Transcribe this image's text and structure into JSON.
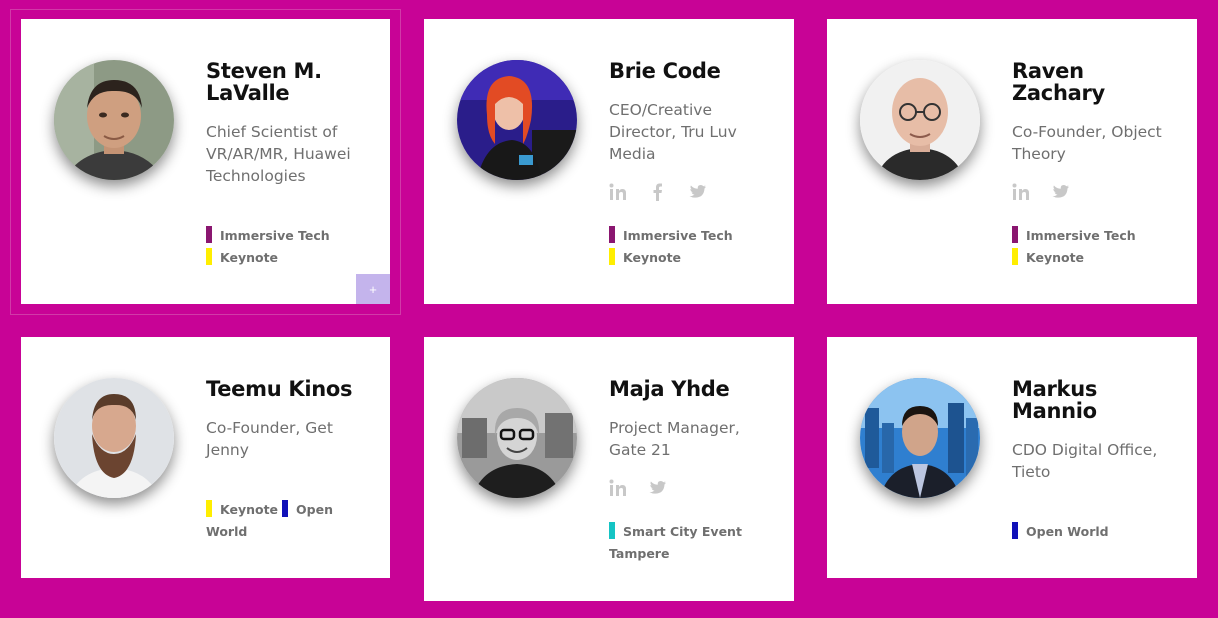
{
  "colors": {
    "background": "#c80396",
    "tag_immersive": "#8a1670",
    "tag_keynote": "#ffee00",
    "tag_open_world": "#1010b8",
    "tag_smart_city": "#15c4c4",
    "plus_button": "#c4b4ec"
  },
  "speakers": [
    {
      "name": "Steven M. LaValle",
      "role": "Chief Scientist of VR/AR/MR, Huawei Technologies",
      "social": [],
      "tags": [
        {
          "label": "Immersive Tech",
          "color": "#8a1670"
        },
        {
          "label": "Keynote",
          "color": "#ffee00"
        }
      ],
      "more_button": "+"
    },
    {
      "name": "Brie Code",
      "role": "CEO/Creative Director, Tru Luv Media",
      "social": [
        "linkedin-icon",
        "facebook-icon",
        "twitter-icon"
      ],
      "tags": [
        {
          "label": "Immersive Tech",
          "color": "#8a1670"
        },
        {
          "label": "Keynote",
          "color": "#ffee00"
        }
      ]
    },
    {
      "name": "Raven Zachary",
      "role": "Co-Founder, Object Theory",
      "social": [
        "linkedin-icon",
        "twitter-icon"
      ],
      "tags": [
        {
          "label": "Immersive Tech",
          "color": "#8a1670"
        },
        {
          "label": "Keynote",
          "color": "#ffee00"
        }
      ]
    },
    {
      "name": "Teemu Kinos",
      "role": "Co-Founder, Get Jenny",
      "social": [],
      "tags": [
        {
          "label": "Keynote",
          "color": "#ffee00"
        },
        {
          "label": "Open World",
          "color": "#1010b8"
        }
      ]
    },
    {
      "name": "Maja Yhde",
      "role": "Project Manager, Gate 21",
      "social": [
        "linkedin-icon",
        "twitter-icon"
      ],
      "tags": [
        {
          "label": "Smart City Event Tampere",
          "color": "#15c4c4"
        }
      ]
    },
    {
      "name": "Markus Mannio",
      "role": "CDO Digital Office, Tieto",
      "social": [],
      "tags": [
        {
          "label": "Open World",
          "color": "#1010b8"
        }
      ]
    }
  ]
}
